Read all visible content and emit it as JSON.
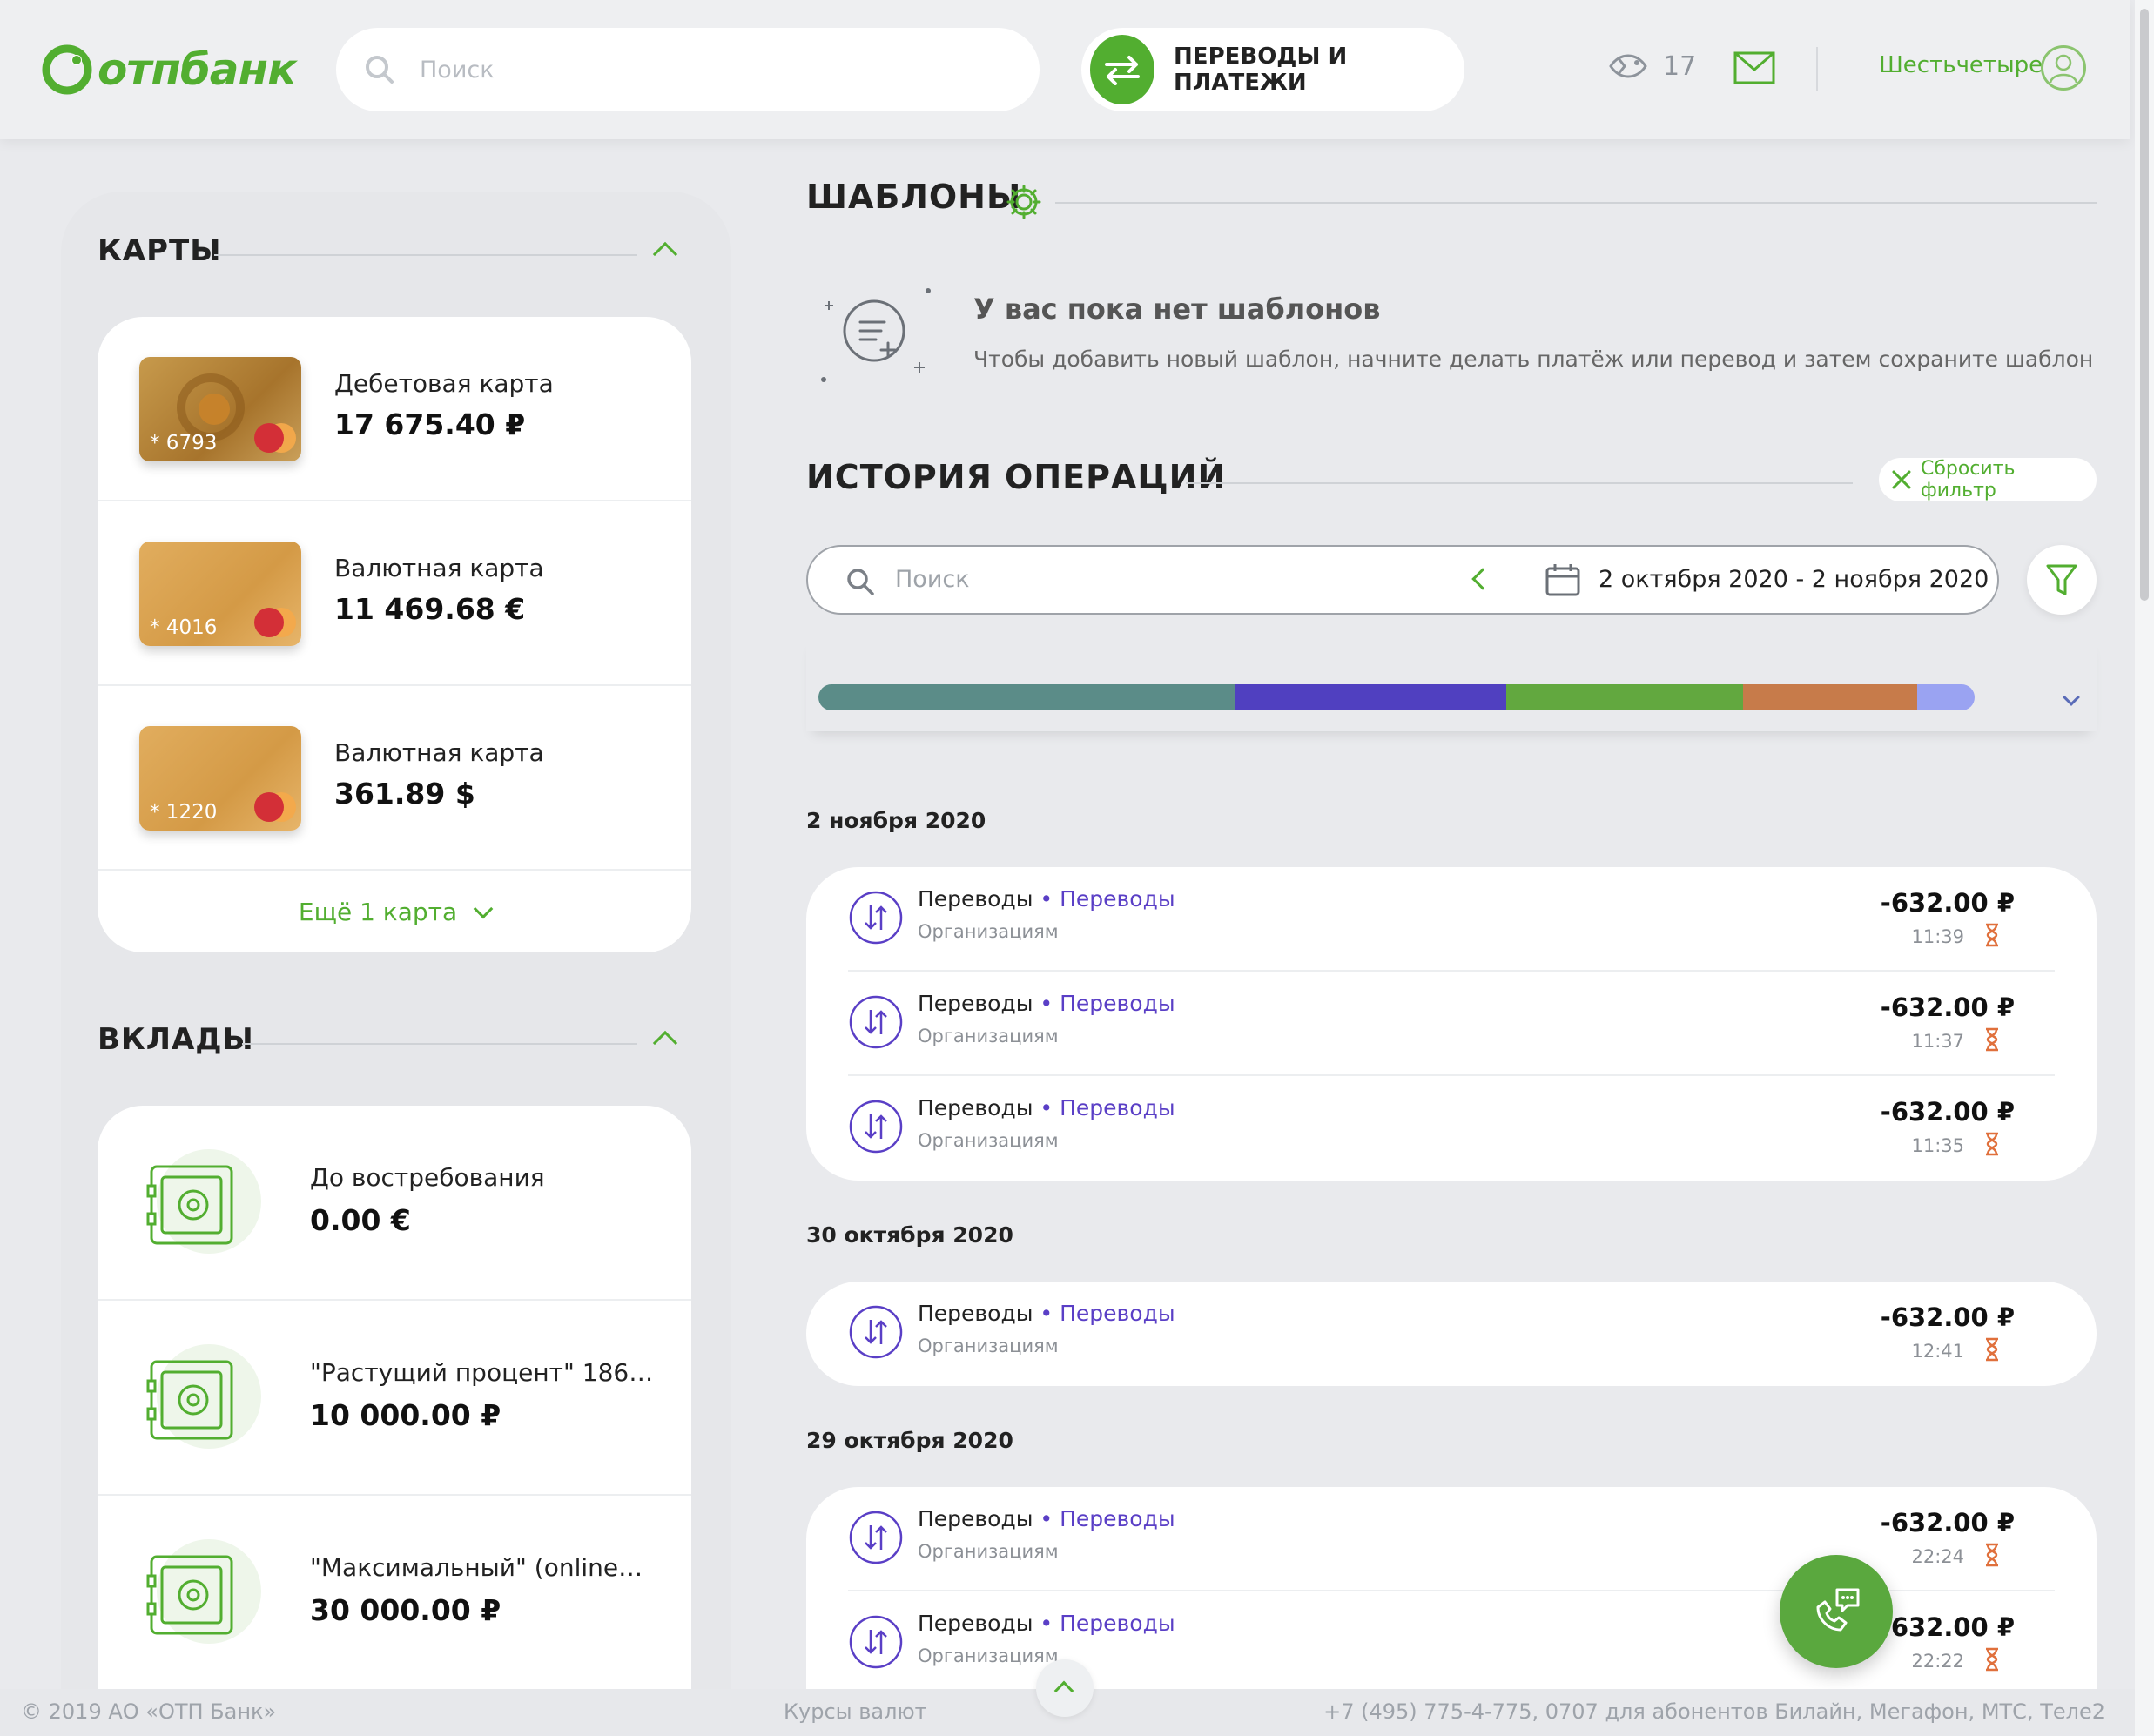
{
  "brand": {
    "name": "отпбанк",
    "color": "#52ae30"
  },
  "header": {
    "search_placeholder": "Поиск",
    "transfers_label": "ПЕРЕВОДЫ И ПЛАТЕЖИ",
    "notifications_count": "17",
    "username": "Шестьчетыре"
  },
  "cards": {
    "title": "КАРТЫ",
    "items": [
      {
        "name": "Дебетовая карта",
        "amount": "17 675.40 ₽",
        "number": "* 6793"
      },
      {
        "name": "Валютная карта",
        "amount": "11 469.68 €",
        "number": "* 4016"
      },
      {
        "name": "Валютная карта",
        "amount": "361.89 $",
        "number": "* 1220"
      }
    ],
    "more_label": "Ещё 1 карта"
  },
  "deposits": {
    "title": "ВКЛАДЫ",
    "items": [
      {
        "name": "До востребования",
        "amount": "0.00 €"
      },
      {
        "name": "\"Растущий процент\" 186…",
        "amount": "10 000.00 ₽"
      },
      {
        "name": "\"Максимальный\" (online…",
        "amount": "30 000.00 ₽"
      }
    ]
  },
  "templates": {
    "title": "ШАБЛОНЫ",
    "empty_title": "У вас пока нет шаблонов",
    "empty_text": "Чтобы добавить новый шаблон, начните делать платёж или перевод и затем сохраните шаблон"
  },
  "history": {
    "title": "ИСТОРИЯ ОПЕРАЦИЙ",
    "reset_label": "Сбросить фильтр",
    "search_placeholder": "Поиск",
    "date_range": "2 октября 2020 - 2 ноября 2020",
    "breakdown": [
      {
        "color": "#5b8c88",
        "share": 0.36
      },
      {
        "color": "#5040c0",
        "share": 0.235
      },
      {
        "color": "#62a83f",
        "share": 0.205
      },
      {
        "color": "#c77b4a",
        "share": 0.15
      },
      {
        "color": "#9aa3f2",
        "share": 0.05
      }
    ],
    "days": [
      {
        "label": "2 ноября 2020",
        "ops": [
          {
            "title": "Переводы",
            "dot": " • ",
            "category": "Переводы",
            "sub": "Организациям",
            "amount": "-632.00 ₽",
            "time": "11:39"
          },
          {
            "title": "Переводы",
            "dot": " • ",
            "category": "Переводы",
            "sub": "Организациям",
            "amount": "-632.00 ₽",
            "time": "11:37"
          },
          {
            "title": "Переводы",
            "dot": " • ",
            "category": "Переводы",
            "sub": "Организациям",
            "amount": "-632.00 ₽",
            "time": "11:35"
          }
        ]
      },
      {
        "label": "30 октября 2020",
        "ops": [
          {
            "title": "Переводы",
            "dot": " • ",
            "category": "Переводы",
            "sub": "Организациям",
            "amount": "-632.00 ₽",
            "time": "12:41"
          }
        ]
      },
      {
        "label": "29 октября 2020",
        "ops": [
          {
            "title": "Переводы",
            "dot": " • ",
            "category": "Переводы",
            "sub": "Организациям",
            "amount": "-632.00 ₽",
            "time": "22:24"
          },
          {
            "title": "Переводы",
            "dot": " • ",
            "category": "Переводы",
            "sub": "Организациям",
            "amount": "-632.00 ₽",
            "time": "22:22"
          }
        ]
      }
    ]
  },
  "footer": {
    "copyright": "© 2019 АО «ОТП Банк»",
    "rates": "Курсы валют",
    "phone": "+7 (495) 775-4-775,  0707 для абонентов Билайн, Мегафон, МТС, Теле2"
  }
}
